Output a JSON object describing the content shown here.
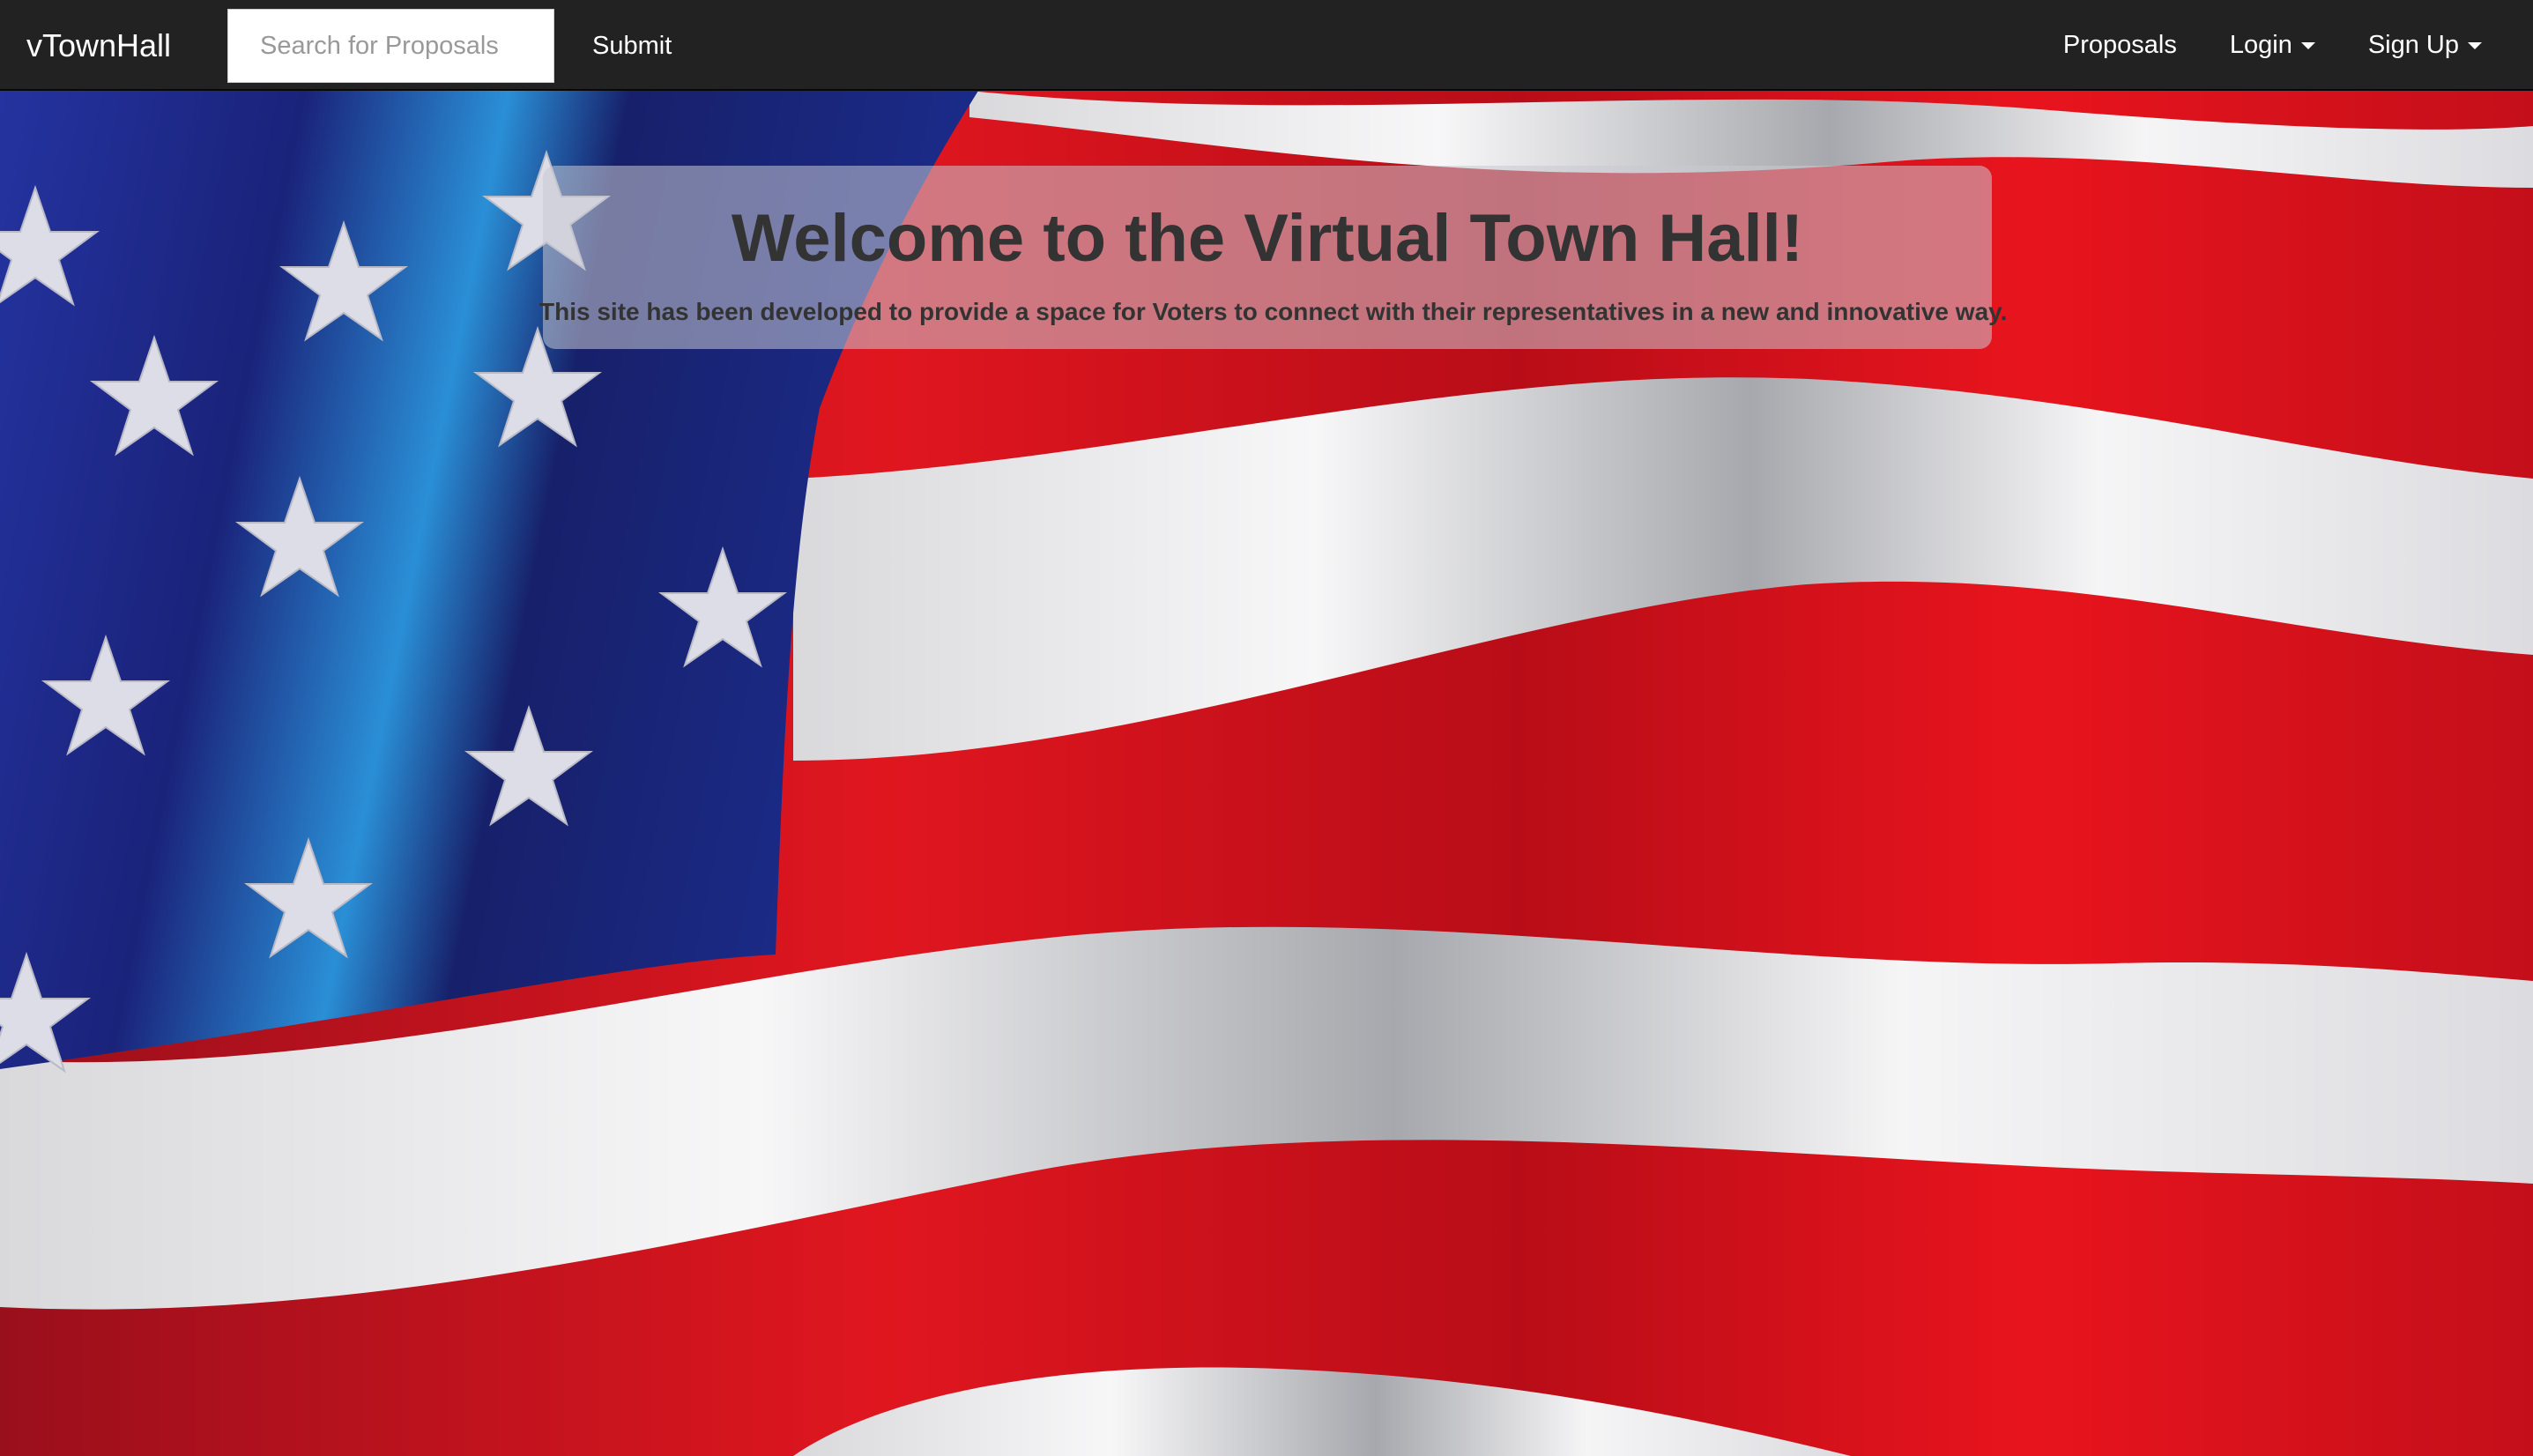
{
  "navbar": {
    "brand": "vTownHall",
    "search_placeholder": "Search for Proposals",
    "submit_label": "Submit",
    "links": {
      "proposals": "Proposals",
      "login": "Login",
      "signup": "Sign Up"
    }
  },
  "hero": {
    "title": "Welcome to the Virtual Town Hall!",
    "subtitle": "This site has been developed to provide a space for Voters to connect with their representatives in a new and innovative way."
  },
  "colors": {
    "navbar_bg": "#222222",
    "flag_red": "#d8141f",
    "flag_white": "#f2f2f4",
    "flag_blue": "#1f2f86"
  }
}
